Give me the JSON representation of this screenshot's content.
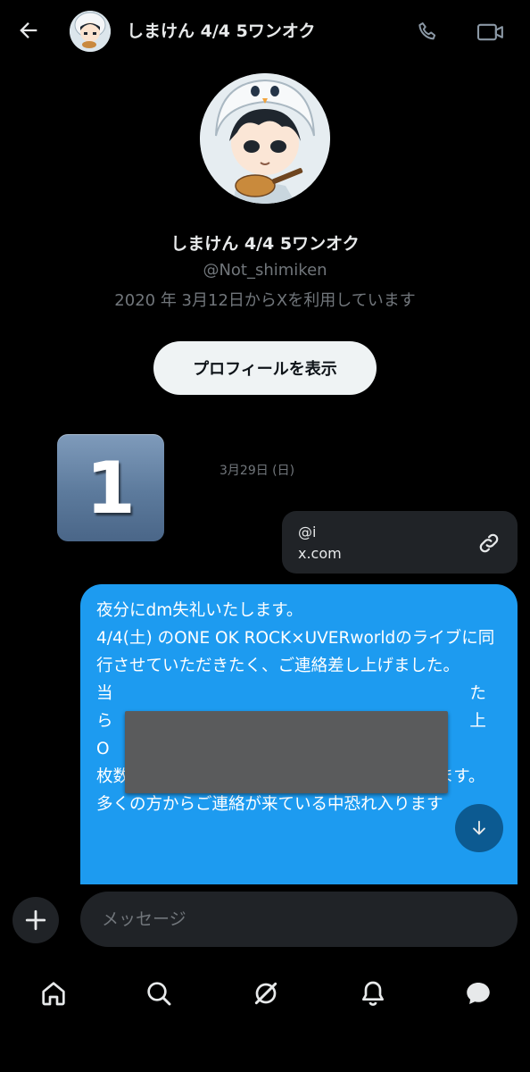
{
  "header": {
    "title": "しまけん 4/4 5ワンオク"
  },
  "profile": {
    "name": "しまけん 4/4 5ワンオク",
    "handle": "@Not_shimiken",
    "joined": "2020 年 3月12日からXを利用しています",
    "view_profile_label": "プロフィールを表示"
  },
  "overlay_number": "1",
  "conversation": {
    "date": "3月29日 (日)",
    "link_card": {
      "title": "@i",
      "domain": "x.com"
    },
    "message_text": "夜分にdm失礼いたします。\n4/4(土) のONE OK ROCK×UVERworldのライブに同行させていただきたく、ご連絡差し上げました。\n当                                                                    た\nら                                                                    上\nO\n枚数は2枚、当日現地でのお取引を希望いたします。\n多くの方からご連絡が来ている中恐れ入ります"
  },
  "composer": {
    "placeholder": "メッセージ"
  },
  "colors": {
    "background": "#000000",
    "bubble": "#1d9bf0",
    "muted": "#71767b",
    "surface": "#202327"
  },
  "nav": [
    "home-icon",
    "search-icon",
    "grok-icon",
    "bell-icon",
    "messages-icon"
  ]
}
